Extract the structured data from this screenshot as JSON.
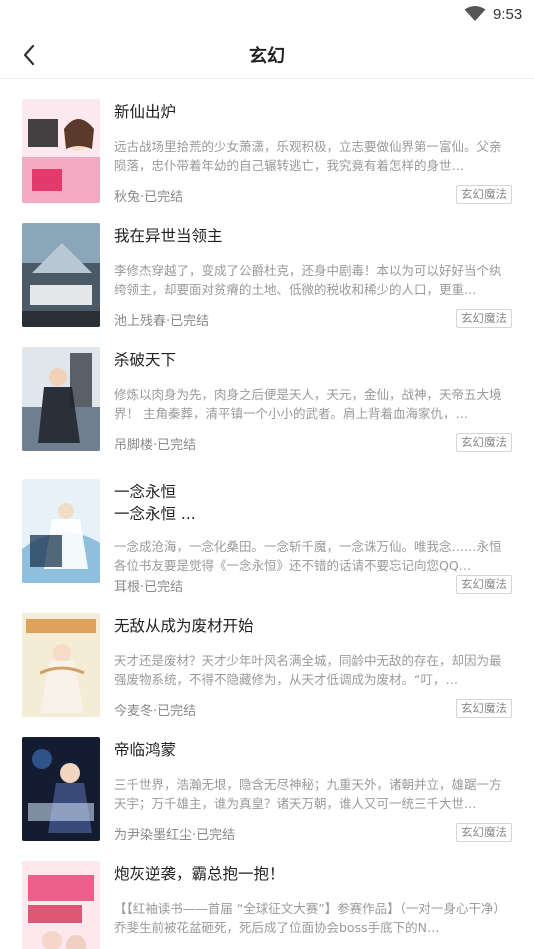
{
  "status_bar": {
    "time": "9:53",
    "wifi_icon": "wifi-icon"
  },
  "header": {
    "title": "玄幻",
    "back_icon": "back-arrow-icon"
  },
  "books": [
    {
      "title": "新仙出炉",
      "description": "远古战场里拾荒的少女萧潇，乐观积极，立志要做仙界第一富仙。父亲陨落，忠仆带着年幼的自己辗转逃亡，我究竟有着怎样的身世…",
      "meta": "秋兔·已完结",
      "tag": "玄幻魔法",
      "cover_colors": [
        "#f7d4df",
        "#e85a8c"
      ]
    },
    {
      "title": "我在异世当领主",
      "description": "李修杰穿越了，变成了公爵杜克，还身中剧毒！本以为可以好好当个纨绔领主，却要面对贫瘠的土地、低微的税收和稀少的人口，更重…",
      "meta": "池上残春·已完结",
      "tag": "玄幻魔法",
      "cover_colors": [
        "#6a8aa0",
        "#3a4a55"
      ]
    },
    {
      "title": "杀破天下",
      "description": "修炼以肉身为先，肉身之后便是天人，天元，金仙，战神，天帝五大境界！ 主角秦葬，清平镇一个小小的武者。肩上背着血海家仇，…",
      "meta": "吊脚楼·已完结",
      "tag": "玄幻魔法",
      "cover_colors": [
        "#c9d6e0",
        "#2f3f55"
      ]
    },
    {
      "title": "一念永恒\n一念永恒 ...",
      "description": "一念成沧海，一念化桑田。一念斩千魔，一念诛万仙。唯我念……永恒 各位书友要是觉得《一念永恒》还不错的话请不要忘记向您QQ…",
      "meta": "耳根·已完结",
      "tag": "玄幻魔法",
      "cover_colors": [
        "#d6eaf5",
        "#4a88b8"
      ]
    },
    {
      "title": "无敌从成为废材开始",
      "description": "天才还是废材？天才少年叶风名满全城，同龄中无敌的存在，却因为最强废物系统，不得不隐藏修为，从天才低调成为废材。“叮，…",
      "meta": "今麦冬·已完结",
      "tag": "玄幻魔法",
      "cover_colors": [
        "#f3e6c8",
        "#c98a4a"
      ]
    },
    {
      "title": "帝临鸿蒙",
      "description": "三千世界，浩瀚无垠，隐含无尽神秘；九重天外，诸朝并立，雄踞一方天宇；万千雄主，谁为真皇？诸天万朝，谁人又可一统三千大世…",
      "meta": "为尹染墨红尘·已完结",
      "tag": "玄幻魔法",
      "cover_colors": [
        "#2a3a6a",
        "#101828"
      ]
    },
    {
      "title": "炮灰逆袭，霸总抱一抱！",
      "description": "【【红袖读书——首届 “全球征文大赛”】参赛作品】（一对一身心干净）乔斐生前被花盆砸死，死后成了位面协会boss手底下的N…",
      "meta": "",
      "tag": "",
      "cover_colors": [
        "#fde3ea",
        "#e8467a"
      ]
    }
  ]
}
